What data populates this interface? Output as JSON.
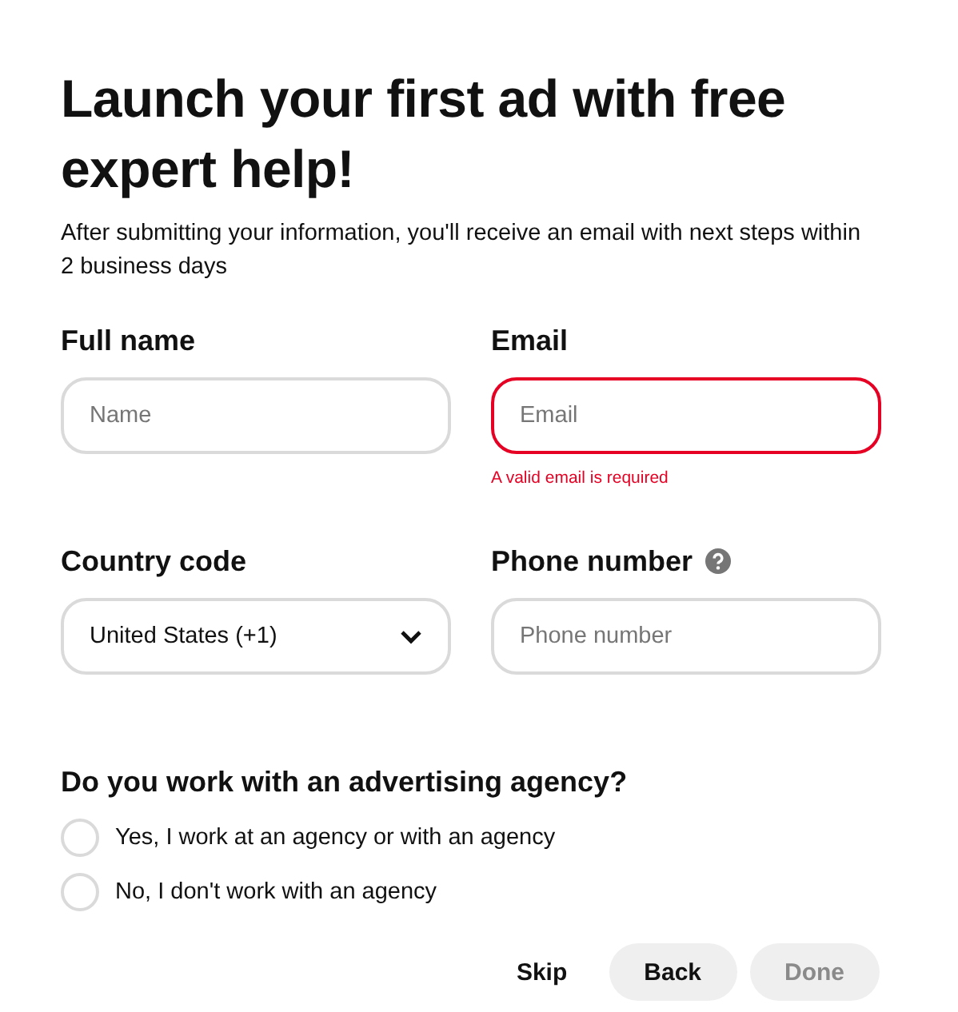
{
  "title": "Launch your first ad with free expert help!",
  "subtitle": "After submitting your information, you'll receive an email with next steps within 2 business days",
  "fields": [
    {
      "kind": "text",
      "label": "Full name",
      "placeholder": "Name",
      "invalid": false
    },
    {
      "kind": "text",
      "label": "Email",
      "placeholder": "Email",
      "invalid": true,
      "error": "A valid email is required"
    },
    {
      "kind": "select",
      "label": "Country code",
      "value": "United States (+1)",
      "invalid": false
    },
    {
      "kind": "text",
      "label": "Phone number",
      "placeholder": "Phone number",
      "invalid": false,
      "help": true
    }
  ],
  "question": "Do you work with an advertising agency?",
  "options": [
    {
      "label": "Yes, I work at an agency or with an agency",
      "selected": false
    },
    {
      "label": "No, I don't work with an agency",
      "selected": false
    }
  ],
  "buttons": [
    {
      "kind": "plain",
      "label": "Skip",
      "disabled": false
    },
    {
      "kind": "pill",
      "label": "Back",
      "disabled": false
    },
    {
      "kind": "pill",
      "label": "Done",
      "disabled": true
    }
  ]
}
